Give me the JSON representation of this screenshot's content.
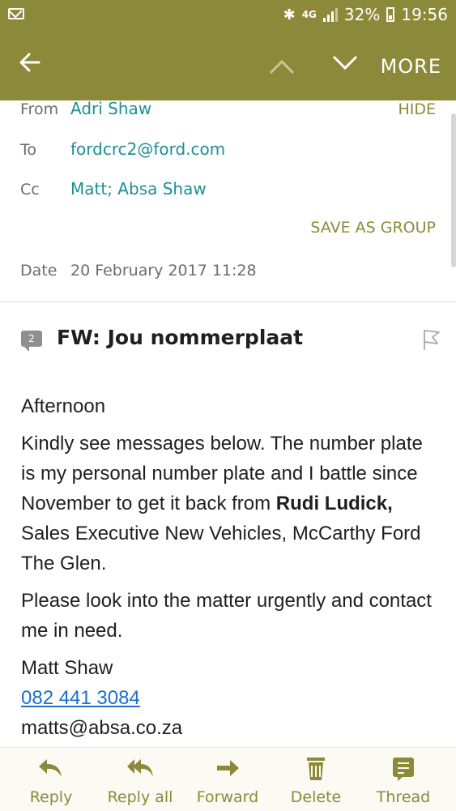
{
  "status_bar": {
    "network": "4G",
    "battery": "32%",
    "time": "19:56"
  },
  "toolbar": {
    "more_label": "MORE"
  },
  "header": {
    "from_label": "From",
    "from_value": "Adri Shaw",
    "hide_label": "HIDE",
    "to_label": "To",
    "to_value": "fordcrc2@ford.com",
    "cc_label": "Cc",
    "cc_value": "Matt; Absa Shaw",
    "save_group_label": "SAVE AS GROUP",
    "date_label": "Date",
    "date_value": "20 February 2017 11:28"
  },
  "message": {
    "thread_count": "2",
    "subject": "FW: Jou nommerplaat",
    "greeting": "Afternoon",
    "para1_a": "Kindly see messages below.  The number plate is my personal number plate and I battle since November to get it back from ",
    "para1_bold": "Rudi Ludick,",
    "para1_b": " Sales Executive New Vehicles, McCarthy Ford The Glen.",
    "para2": "Please look into the matter urgently and contact me in need.",
    "sig_name": "Matt Shaw",
    "sig_phone": "082 441 3084",
    "sig_email": "matts@absa.co.za"
  },
  "bottom_bar": {
    "reply": "Reply",
    "reply_all": "Reply all",
    "forward": "Forward",
    "delete": "Delete",
    "thread": "Thread"
  }
}
